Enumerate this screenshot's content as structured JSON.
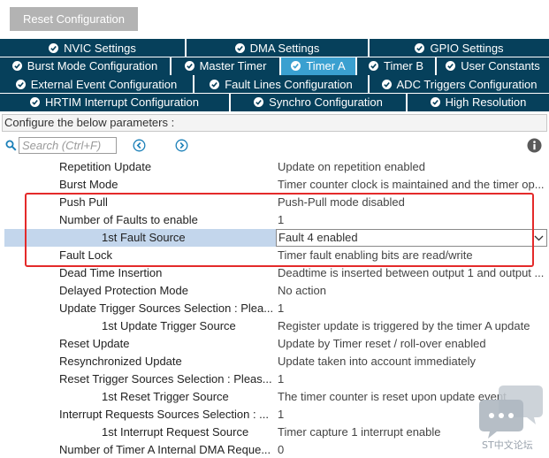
{
  "reset_button": {
    "label": "Reset Configuration"
  },
  "tabs": {
    "row1": [
      {
        "label": "NVIC Settings",
        "active": false
      },
      {
        "label": "DMA Settings",
        "active": false
      },
      {
        "label": "GPIO Settings",
        "active": false
      }
    ],
    "row2": [
      {
        "label": "Burst Mode Configuration",
        "active": false
      },
      {
        "label": "Master Timer",
        "active": false
      },
      {
        "label": "Timer A",
        "active": true
      },
      {
        "label": "Timer B",
        "active": false
      },
      {
        "label": "User Constants",
        "active": false
      }
    ],
    "row3": [
      {
        "label": "External Event Configuration",
        "active": false
      },
      {
        "label": "Fault Lines Configuration",
        "active": false
      },
      {
        "label": "ADC Triggers Configuration",
        "active": false
      }
    ],
    "row4": [
      {
        "label": "HRTIM Interrupt Configuration",
        "active": false
      },
      {
        "label": "Synchro Configuration",
        "active": false
      },
      {
        "label": "High Resolution",
        "active": false
      }
    ]
  },
  "configure_label": "Configure the below parameters :",
  "search": {
    "placeholder": "Search (Ctrl+F)"
  },
  "params": [
    {
      "name": "Repetition Update",
      "value": "Update on repetition enabled",
      "indent": false
    },
    {
      "name": "Burst Mode",
      "value": "Timer counter clock is maintained and the timer op...",
      "indent": false
    },
    {
      "name": "Push Pull",
      "value": "Push-Pull mode disabled",
      "indent": false
    },
    {
      "name": "Number of Faults to enable",
      "value": "1",
      "indent": false
    },
    {
      "name": "1st Fault Source",
      "value": "Fault 4 enabled",
      "indent": true,
      "selected": true
    },
    {
      "name": "Fault Lock",
      "value": "Timer fault enabling bits are read/write",
      "indent": false
    },
    {
      "name": "Dead Time Insertion",
      "value": "Deadtime is inserted between output 1 and output ...",
      "indent": false
    },
    {
      "name": "Delayed Protection Mode",
      "value": "No action",
      "indent": false
    },
    {
      "name": "Update Trigger Sources Selection : Plea...",
      "value": "1",
      "indent": false
    },
    {
      "name": "1st Update Trigger Source",
      "value": "Register update is triggered by the timer A update",
      "indent": true
    },
    {
      "name": "Reset Update",
      "value": "Update by Timer reset / roll-over enabled",
      "indent": false
    },
    {
      "name": "Resynchronized Update",
      "value": "Update taken into account immediately",
      "indent": false
    },
    {
      "name": "Reset Trigger Sources Selection : Pleas...",
      "value": "1",
      "indent": false
    },
    {
      "name": "1st Reset Trigger Source",
      "value": "The timer counter is reset upon update event",
      "indent": true
    },
    {
      "name": "Interrupt Requests Sources Selection : ...",
      "value": "1",
      "indent": false
    },
    {
      "name": "1st Interrupt Request Source",
      "value": "Timer capture 1 interrupt enable",
      "indent": true
    },
    {
      "name": "Number of Timer A Internal DMA Reque...",
      "value": "0",
      "indent": false
    }
  ],
  "watermark": {
    "text": "ST中文论坛"
  },
  "colors": {
    "tab_bg": "#06405b",
    "tab_active_bg": "#3aa0d0",
    "selected_row_bg": "#c3d6ec",
    "highlight_frame": "#e42a2a"
  }
}
